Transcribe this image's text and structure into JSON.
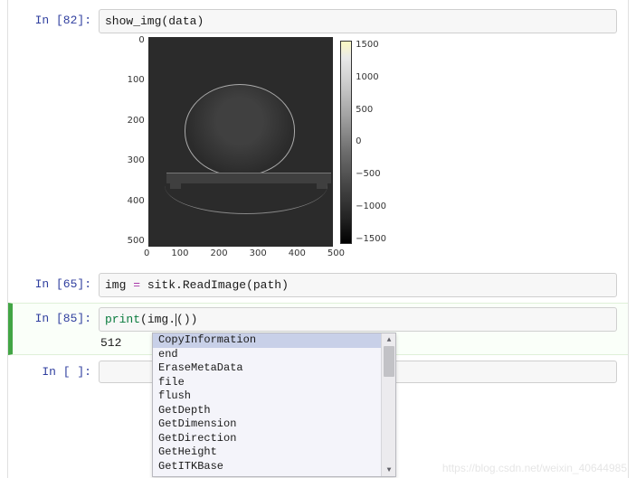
{
  "cells": [
    {
      "prompt_in": "In",
      "prompt_num": "[82]:",
      "code_parts": {
        "func": "show_img",
        "open": "(",
        "arg": "data",
        "close": ")"
      }
    },
    {
      "prompt_in": "In",
      "prompt_num": "[65]:",
      "code_parts": {
        "lhs": "img",
        "op": " = ",
        "mod": "sitk",
        "dot": ".",
        "rfunc": "ReadImage",
        "open": "(",
        "arg": "path",
        "close": ")"
      }
    },
    {
      "prompt_in": "In",
      "prompt_num": "[85]:",
      "code_parts": {
        "builtin": "print",
        "open": "(",
        "obj": "img",
        "dot": ".",
        "suffix": "()",
        "close": ")"
      },
      "output": "512"
    },
    {
      "prompt_in": "In",
      "prompt_num": "[ ]:"
    }
  ],
  "autocomplete": {
    "items": [
      "CopyInformation",
      "end",
      "EraseMetaData",
      "file",
      "flush",
      "GetDepth",
      "GetDimension",
      "GetDirection",
      "GetHeight",
      "GetITKBase"
    ],
    "selected_index": 0
  },
  "chart_data": {
    "type": "heatmap",
    "x_ticks": [
      "0",
      "100",
      "200",
      "300",
      "400",
      "500"
    ],
    "y_ticks": [
      "0",
      "100",
      "200",
      "300",
      "400",
      "500"
    ],
    "colorbar_ticks": [
      "1500",
      "1000",
      "500",
      "0",
      "−500",
      "−1000",
      "−1500"
    ],
    "xlim": [
      0,
      512
    ],
    "ylim": [
      0,
      512
    ],
    "value_range": [
      -1500,
      1500
    ],
    "description": "Axial CT slice (head phantom on scanner table), grayscale with colorbar"
  },
  "watermark": "https://blog.csdn.net/weixin_40644985"
}
